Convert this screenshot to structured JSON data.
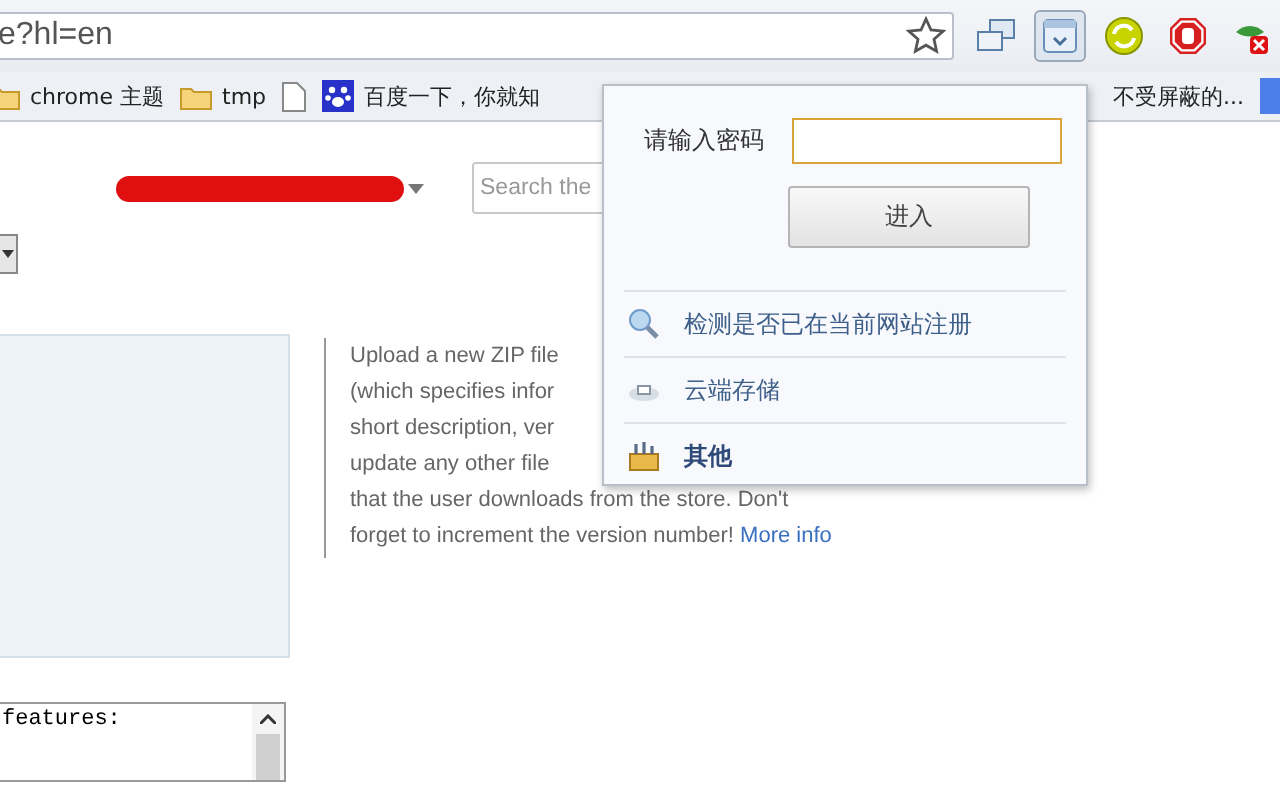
{
  "toolbar": {
    "address": "e?hl=en",
    "extensions": [
      {
        "kind": "windows",
        "selected": false
      },
      {
        "kind": "download",
        "selected": true
      },
      {
        "kind": "sync",
        "selected": false
      },
      {
        "kind": "stop",
        "selected": false
      },
      {
        "kind": "leaf",
        "selected": false
      }
    ]
  },
  "bookmarks": [
    {
      "kind": "folder",
      "label": "chrome  主题"
    },
    {
      "kind": "folder",
      "label": "tmp"
    },
    {
      "kind": "page"
    },
    {
      "kind": "paw",
      "label": "百度一下，你就知"
    }
  ],
  "bookmarks_right": {
    "label": "不受屏蔽的..."
  },
  "page": {
    "search": {
      "placeholder": "Search the"
    },
    "description_lines": [
      "Upload a new ZIP file",
      "(which specifies infor",
      "short description, ver",
      "update any other file",
      "that the user downloads from the store. Don't",
      "forget to increment the version number!"
    ],
    "more_link": "More info",
    "textarea_text": "features:"
  },
  "popup": {
    "password_label": "请输入密码",
    "enter_button": "进入",
    "items": [
      {
        "kind": "search",
        "label": "检测是否已在当前网站注册",
        "bold": false
      },
      {
        "kind": "cloud",
        "label": "云端存储",
        "bold": false
      },
      {
        "kind": "toolbox",
        "label": "其他",
        "bold": true
      }
    ]
  }
}
